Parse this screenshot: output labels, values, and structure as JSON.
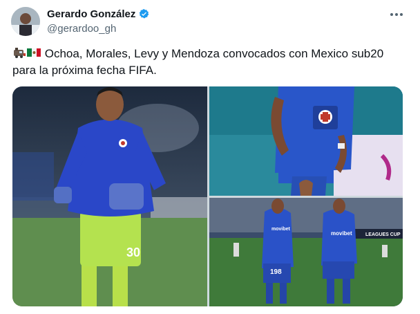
{
  "author": {
    "display_name": "Gerardo González",
    "handle": "@gerardoo_gh",
    "verified": true,
    "avatar_icon": "profile-photo"
  },
  "tweet": {
    "text": " Ochoa, Morales, Levy y Mendoza convocados con Mexico sub20 para la próxima fecha FIFA.",
    "emojis": [
      "train-emoji",
      "mexico-flag-emoji"
    ]
  },
  "media": {
    "count": 3,
    "images": [
      {
        "description_icon": "goalkeeper-photo",
        "jersey_number": "30"
      },
      {
        "description_icon": "player-closeup-photo"
      },
      {
        "description_icon": "players-walking-photo",
        "jersey_number": "198"
      }
    ],
    "sponsor_text": "movibet",
    "banner_text": "LEAGUES CUP"
  },
  "colors": {
    "verified_blue": "#1d9bf0",
    "text_primary": "#0f1419",
    "text_secondary": "#536471",
    "cruz_azul_blue": "#1f4bb8",
    "pitch_green": "#3f7a3a"
  }
}
